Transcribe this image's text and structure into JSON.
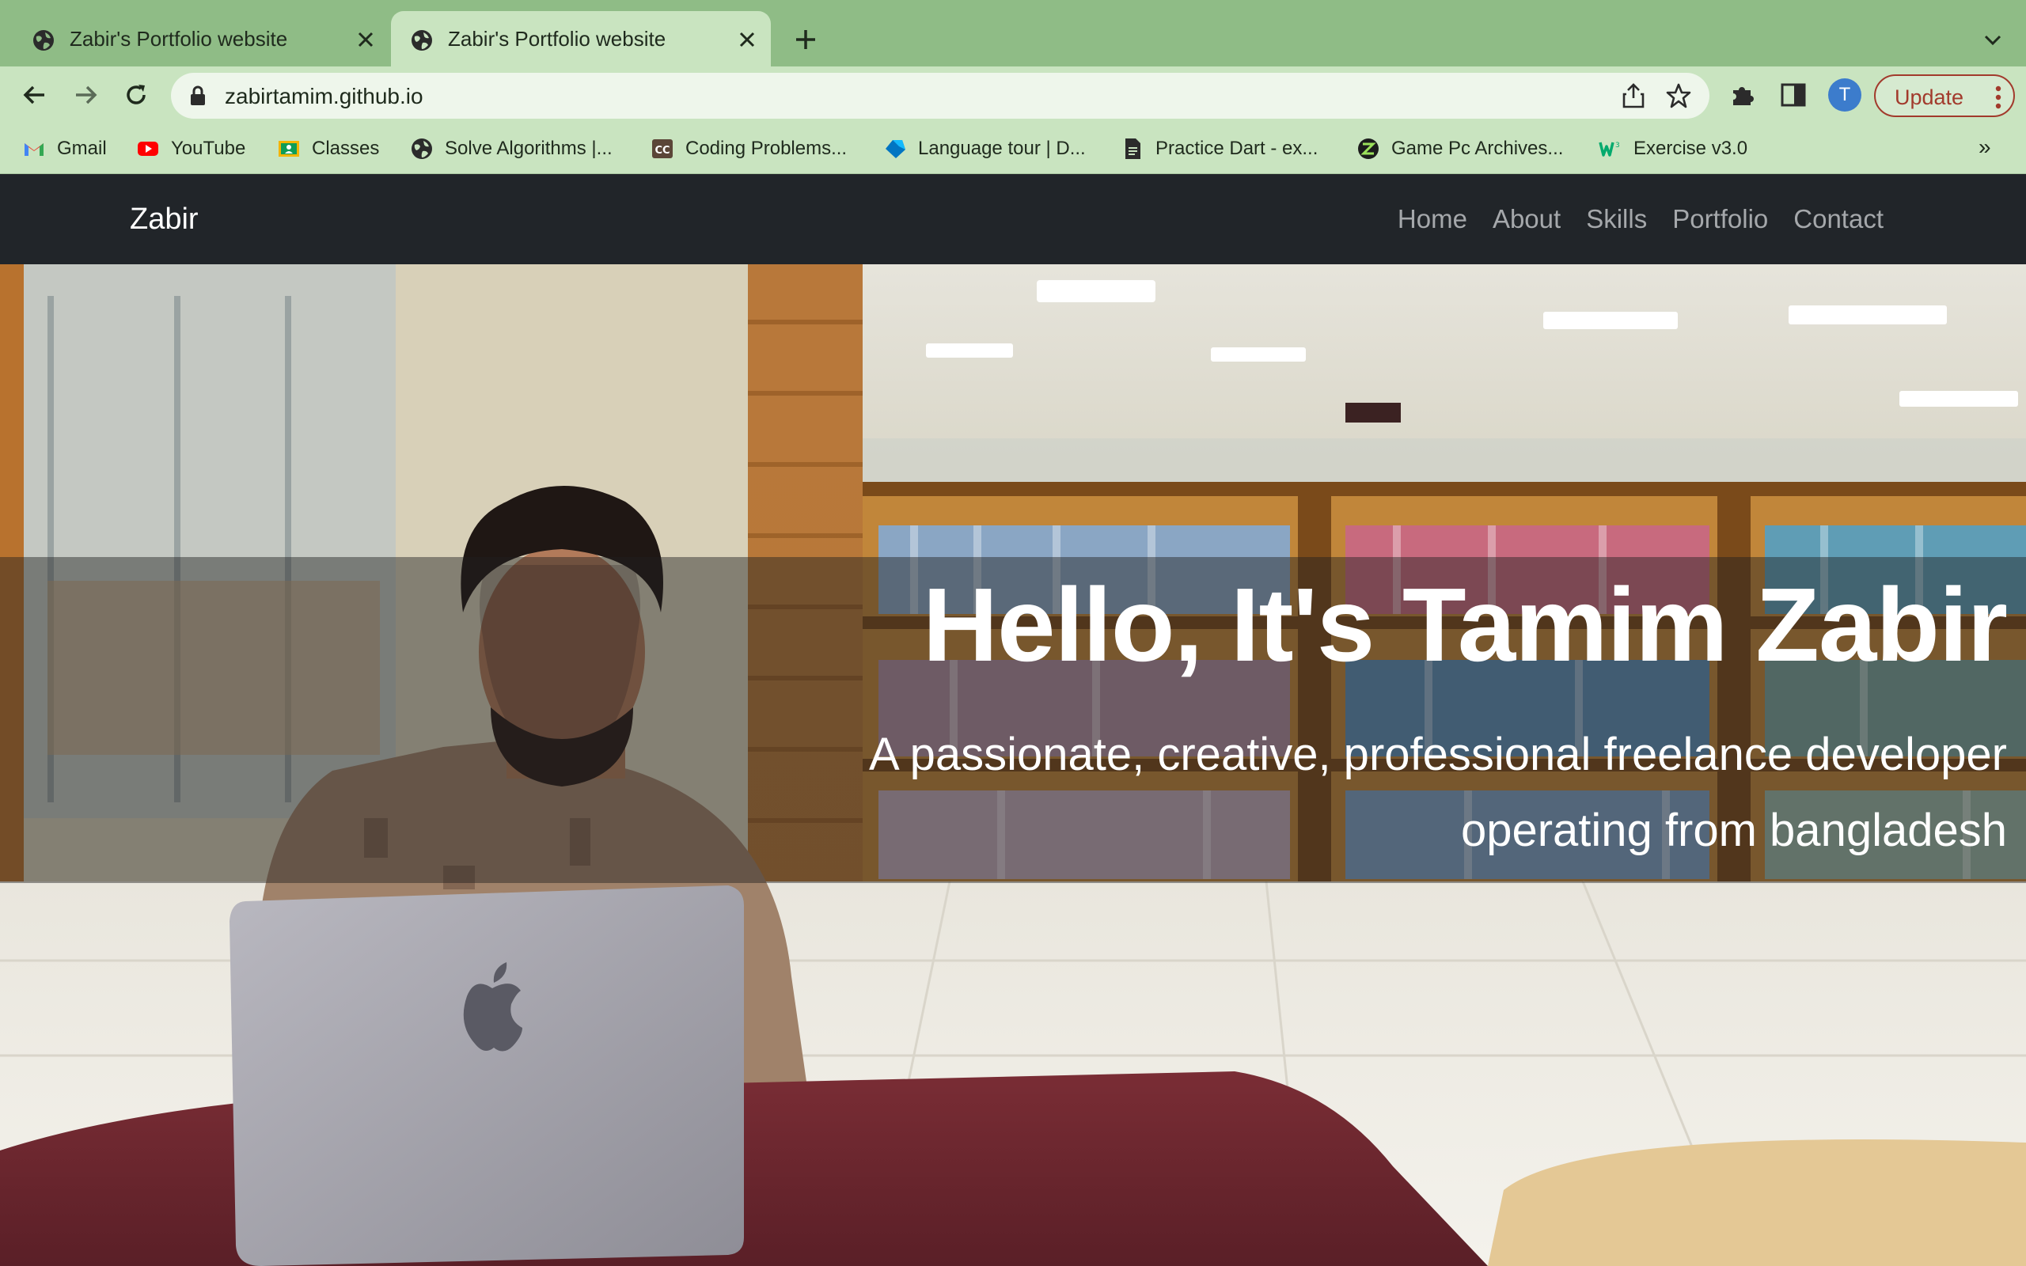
{
  "browser": {
    "tabs": [
      {
        "title": "Zabir's Portfolio website",
        "active": false
      },
      {
        "title": "Zabir's Portfolio website",
        "active": true
      }
    ],
    "url": "zabirtamim.github.io",
    "profile_initial": "T",
    "update_label": "Update",
    "bookmarks": [
      {
        "label": "Gmail",
        "icon": "gmail-icon"
      },
      {
        "label": "YouTube",
        "icon": "youtube-icon"
      },
      {
        "label": "Classes",
        "icon": "google-classroom-icon"
      },
      {
        "label": "Solve Algorithms |...",
        "icon": "globe-icon"
      },
      {
        "label": "Coding Problems...",
        "icon": "codechef-icon"
      },
      {
        "label": "Language tour | D...",
        "icon": "dart-icon"
      },
      {
        "label": "Practice Dart - ex...",
        "icon": "document-icon"
      },
      {
        "label": "Game Pc Archives...",
        "icon": "zigzag-icon"
      },
      {
        "label": "Exercise v3.0",
        "icon": "w3schools-icon"
      }
    ],
    "bookmarks_overflow": "»"
  },
  "site": {
    "brand": "Zabir",
    "nav": [
      "Home",
      "About",
      "Skills",
      "Portfolio",
      "Contact"
    ],
    "hero": {
      "title": "Hello, It's Tamim Zabir",
      "subtitle": "A passionate, creative, professional freelance developer operating from bangladesh"
    }
  },
  "colors": {
    "tabstrip": "#8fbc86",
    "toolbar": "#c9e4c0",
    "navbar": "#212529",
    "update_accent": "#a23a2c"
  }
}
